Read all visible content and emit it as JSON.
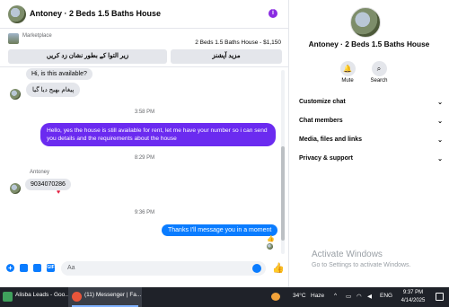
{
  "header": {
    "title": "Antoney · 2 Beds 1.5 Baths House",
    "more_icon": "info-icon"
  },
  "marketplace": {
    "label": "Marketplace",
    "listing": "2 Beds 1.5 Baths House - $1,150",
    "buttons": [
      "زیر التوا کے بطور نشان زد کریں",
      "مزید آپشنز"
    ]
  },
  "messages": {
    "incoming_top_1": "Hi, is this available?",
    "incoming_top_2": "پیغام بھیج دیا گیا",
    "timestamp_1": "3:58 PM",
    "outgoing_1": "Hello, yes the house is still available for rent, let me have your number so i can send you details and the requirements about the house",
    "timestamp_2": "8:29 PM",
    "sender_name": "Antoney",
    "incoming_phone": "9034070286",
    "timestamp_3": "9:36 PM",
    "outgoing_2": "Thanks I'll message you in a moment"
  },
  "composer": {
    "placeholder": "Aa"
  },
  "info_panel": {
    "title": "Antoney · 2 Beds 1.5 Baths House",
    "actions": [
      {
        "label": "Mute",
        "icon": "bell-icon"
      },
      {
        "label": "Search",
        "icon": "search-icon"
      }
    ],
    "sections": [
      "Customize chat",
      "Chat members",
      "Media, files and links",
      "Privacy & support"
    ],
    "watermark_title": "Activate Windows",
    "watermark_sub": "Go to Settings to activate Windows."
  },
  "taskbar": {
    "item_1": "Alisba Leads - Goo...",
    "item_2": "(11) Messenger | Fa...",
    "temperature": "34°C",
    "weather": "Haze",
    "language": "ENG",
    "time": "9:37 PM",
    "date": "4/14/2025"
  },
  "colors": {
    "outgoing_purple": "#6b2bf0",
    "outgoing_blue": "#0a7cff",
    "incoming_gray": "#e4e6eb",
    "taskbar": "#1f2229"
  }
}
